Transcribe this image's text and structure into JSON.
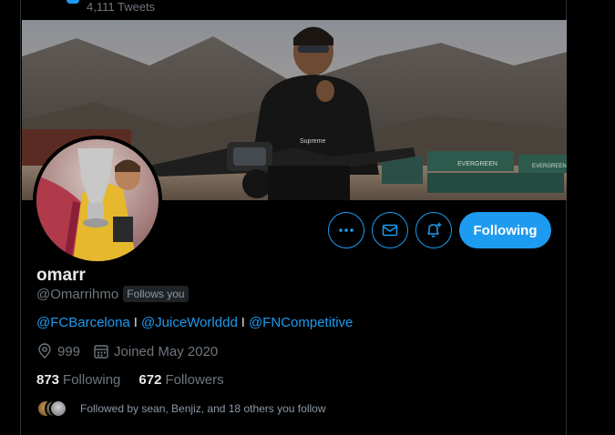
{
  "header": {
    "tweet_count": "4,111 Tweets"
  },
  "profile": {
    "name": "omarr",
    "handle": "@Omarrihmo",
    "follows_you": "Follows you",
    "bio": {
      "link1": "@FCBarcelona",
      "sep1": "I",
      "link2": "@JuiceWorlddd",
      "sep2": "I",
      "link3": "@FNCompetitive"
    },
    "location": "999",
    "joined": "Joined May 2020",
    "following_count": "873",
    "following_label": "Following",
    "followers_count": "672",
    "followers_label": "Followers",
    "followed_by": "Followed by sean, Benjiz, and 18 others you follow"
  },
  "actions": {
    "follow_label": "Following"
  },
  "banner": {
    "sign_text_1": "EVERGREEN",
    "sign_text_2": "EVERGREEN",
    "shirt_text": "Supreme"
  },
  "colors": {
    "accent": "#1d9bf0",
    "background": "#000000",
    "muted": "#6e767d"
  },
  "icons": [
    "more-icon",
    "mail-icon",
    "notification-bell-icon",
    "location-icon",
    "calendar-icon"
  ]
}
